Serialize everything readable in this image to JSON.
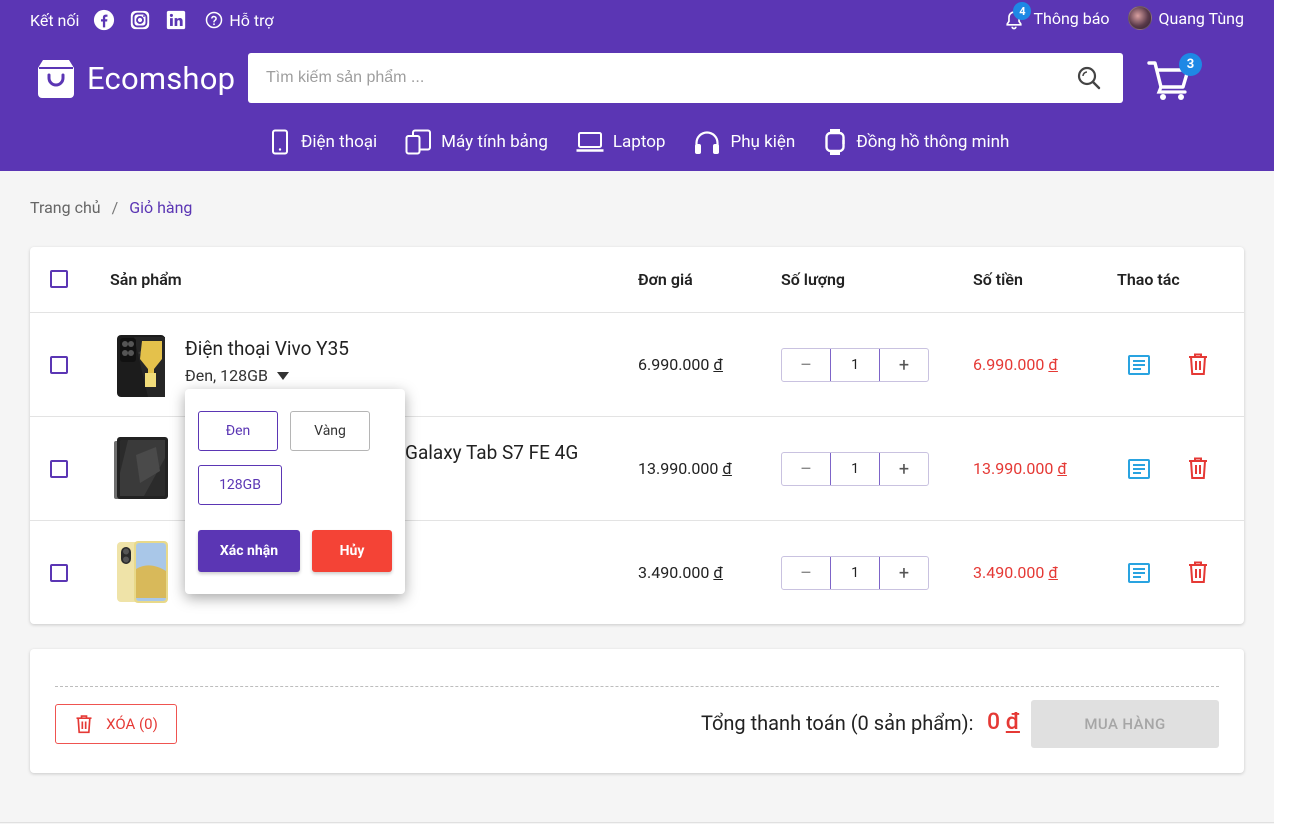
{
  "topbar": {
    "connect_label": "Kết nối",
    "support_label": "Hỗ trợ",
    "notifications_label": "Thông báo",
    "notifications_count": "4",
    "user_name": "Quang Tùng"
  },
  "brand": {
    "name": "Ecomshop"
  },
  "search": {
    "placeholder": "Tìm kiếm sản phẩm ..."
  },
  "cart_count": "3",
  "categories": [
    {
      "label": "Điện thoại",
      "icon": "phone-icon"
    },
    {
      "label": "Máy tính bảng",
      "icon": "tablet-icon"
    },
    {
      "label": "Laptop",
      "icon": "laptop-icon"
    },
    {
      "label": "Phụ kiện",
      "icon": "headphones-icon"
    },
    {
      "label": "Đồng hồ thông minh",
      "icon": "watch-icon"
    }
  ],
  "breadcrumb": {
    "home": "Trang chủ",
    "separator": "/",
    "current": "Giỏ hàng"
  },
  "table": {
    "headers": {
      "product": "Sản phẩm",
      "unit_price": "Đơn giá",
      "quantity": "Số lượng",
      "amount": "Số tiền",
      "actions": "Thao tác"
    },
    "rows": [
      {
        "name": "Điện thoại Vivo Y35",
        "variant": "Đen, 128GB",
        "price": "6.990.000",
        "quantity": "1",
        "subtotal": "6.990.000"
      },
      {
        "name": "Galaxy Tab S7 FE 4G",
        "price": "13.990.000",
        "quantity": "1",
        "subtotal": "13.990.000"
      },
      {
        "price": "3.490.000",
        "quantity": "1",
        "subtotal": "3.490.000"
      }
    ],
    "currency": "đ"
  },
  "variant_popover": {
    "colors": [
      "Đen",
      "Vàng"
    ],
    "storage": [
      "128GB"
    ],
    "confirm_label": "Xác nhận",
    "cancel_label": "Hủy"
  },
  "summary": {
    "delete_label": "XÓA (0)",
    "total_label": "Tổng thanh toán (0 sản phẩm):",
    "total_value": "0",
    "buy_label": "MUA HÀNG"
  },
  "colors": {
    "primary": "#5b36b4",
    "danger": "#e53935",
    "badge": "#1e88e5",
    "info": "#29a3e0"
  }
}
